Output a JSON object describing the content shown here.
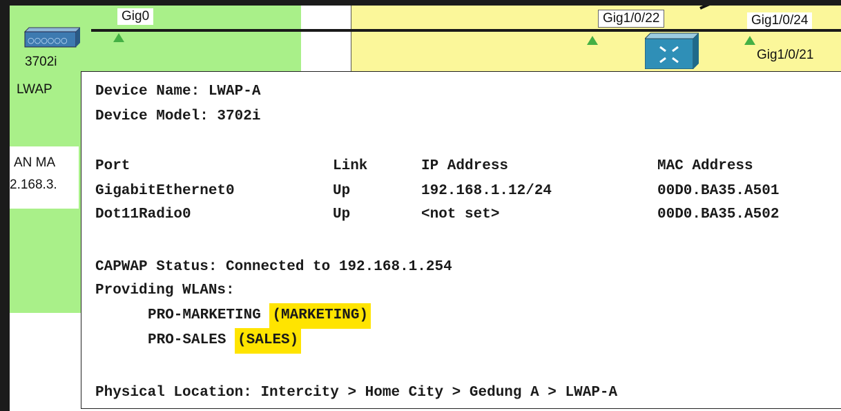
{
  "topology": {
    "ap_port_label": "Gig0",
    "ap_model_label": "3702i",
    "ap_name_label": "LWAP",
    "left_partial_1": "AN MA",
    "left_partial_2": "2.168.3.",
    "switch_port_a": "Gig1/0/22",
    "switch_port_b": "Gig1/0/24",
    "switch_port_c": "Gig1/0/21"
  },
  "tooltip": {
    "device_name": "Device Name: LWAP-A",
    "device_model": "Device Model: 3702i",
    "headers": [
      "Port",
      "Link",
      "IP Address",
      "MAC Address"
    ],
    "rows": [
      {
        "port": "GigabitEthernet0",
        "link": "Up",
        "ip": "192.168.1.12/24",
        "mac": "00D0.BA35.A501"
      },
      {
        "port": "Dot11Radio0",
        "link": "Up",
        "ip": "<not set>",
        "mac": "00D0.BA35.A502"
      }
    ],
    "capwap_status": "CAPWAP Status: Connected to 192.168.1.254",
    "providing_wlans": "Providing WLANs:",
    "wlans": [
      {
        "name": "PRO-MARKETING",
        "group": "(MARKETING)"
      },
      {
        "name": "PRO-SALES",
        "group": "(SALES)"
      }
    ],
    "physical_location": "Physical Location: Intercity > Home City > Gedung A > LWAP-A",
    "highlight_color": "#ffe400"
  }
}
